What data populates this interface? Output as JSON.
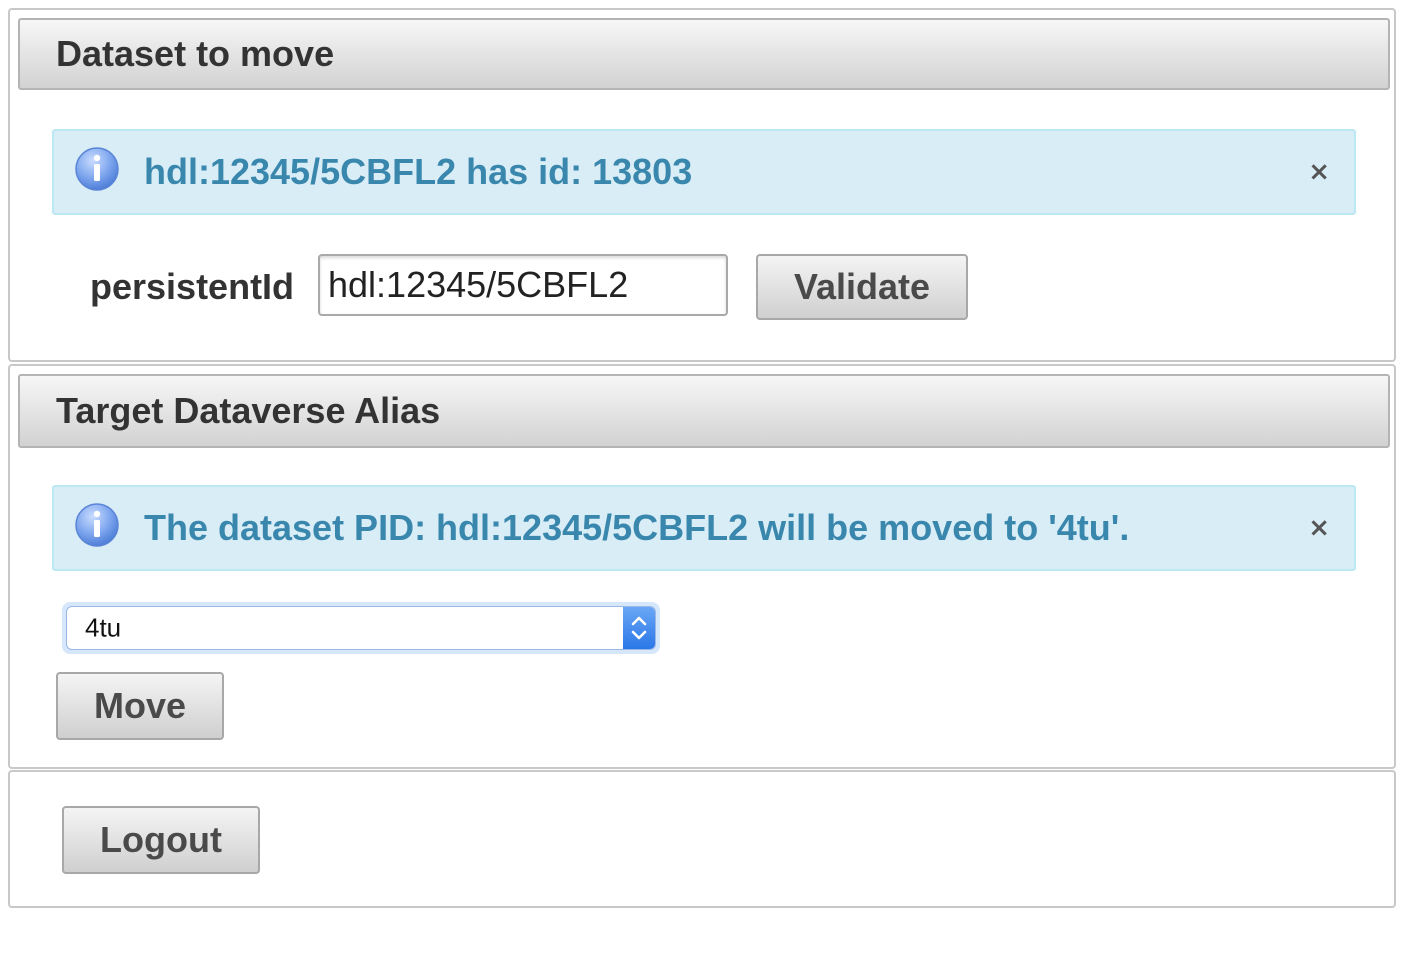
{
  "dataset_panel": {
    "title": "Dataset to move",
    "message": "hdl:12345/5CBFL2 has id: 13803",
    "close_symbol": "×",
    "pid_label": "persistentId",
    "pid_value": "hdl:12345/5CBFL2",
    "validate_label": "Validate"
  },
  "target_panel": {
    "title": "Target Dataverse Alias",
    "message": "The dataset PID: hdl:12345/5CBFL2 will be moved to '4tu'.",
    "close_symbol": "×",
    "selected_alias": "4tu",
    "move_label": "Move"
  },
  "footer_panel": {
    "logout_label": "Logout"
  },
  "icons": {
    "info": "info-icon",
    "close": "close-icon",
    "select_arrows": "chevron-up-down-icon"
  },
  "colors": {
    "info_background": "#d9edf7",
    "info_border": "#bce8f1",
    "info_text": "#3a87ad",
    "select_accent": "#2a77e8"
  }
}
